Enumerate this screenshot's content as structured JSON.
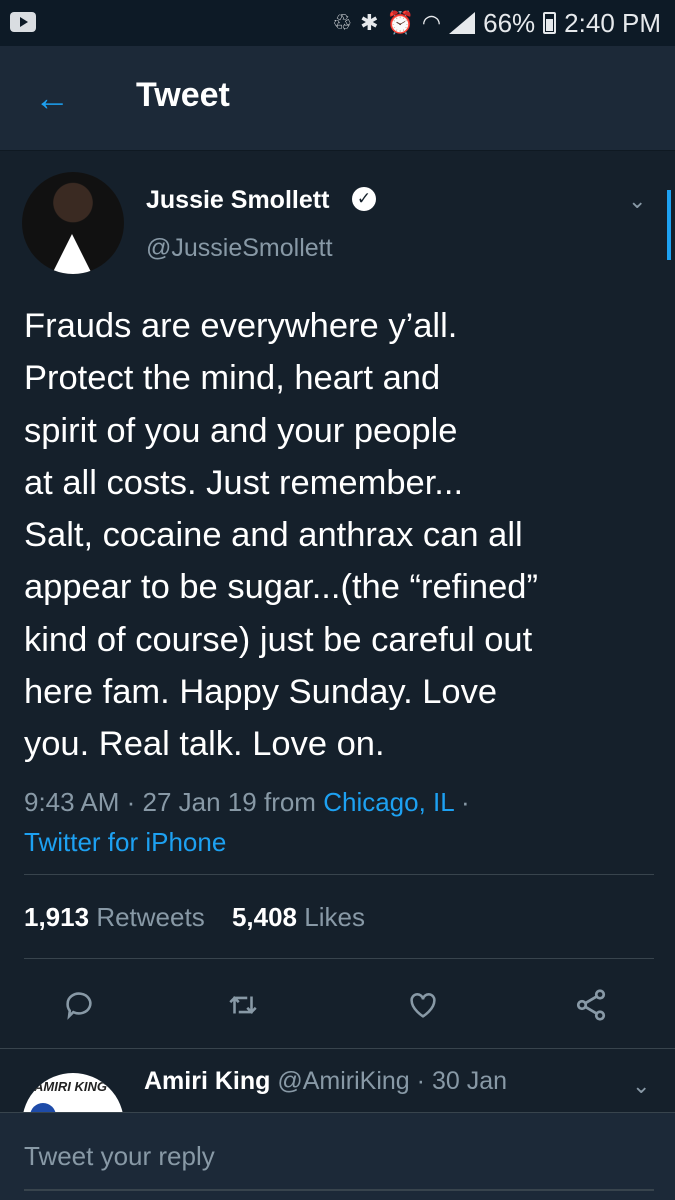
{
  "status_bar": {
    "battery_percent": "66%",
    "time": "2:40 PM",
    "icons": [
      "app-notification-icon",
      "recycle-icon",
      "bluetooth-icon",
      "alarm-icon",
      "wifi-icon",
      "signal-icon",
      "battery-icon"
    ]
  },
  "app_bar": {
    "title": "Tweet",
    "back_icon": "back-arrow-icon"
  },
  "tweet": {
    "author_name": "Jussie Smollett",
    "handle": "@JussieSmollett",
    "verified": true,
    "text": "Frauds are everywhere y’all.\nProtect the mind, heart and\nspirit of you and your people\nat all costs. Just remember...\nSalt, cocaine and anthrax can all\nappear to be sugar...(the “refined”\nkind of course) just be careful out\nhere fam. Happy Sunday. Love\nyou. Real talk. Love on.",
    "time": "9:43 AM",
    "date": "27 Jan 19",
    "from_label": "from",
    "location": "Chicago, IL",
    "client": "Twitter for iPhone",
    "retweets_count": "1,913",
    "retweets_label": "Retweets",
    "likes_count": "5,408",
    "likes_label": "Likes"
  },
  "actions": [
    "reply-icon",
    "retweet-icon",
    "like-icon",
    "share-icon"
  ],
  "reply_preview": {
    "avatar_text": "AMIRI KING",
    "name": "Amiri King",
    "handle": "@AmiriKing",
    "date": "30 Jan"
  },
  "compose": {
    "placeholder": "Tweet your reply"
  },
  "colors": {
    "background": "#15202b",
    "header": "#1c2938",
    "accent": "#1da1f2",
    "secondary_text": "#8899a6"
  }
}
